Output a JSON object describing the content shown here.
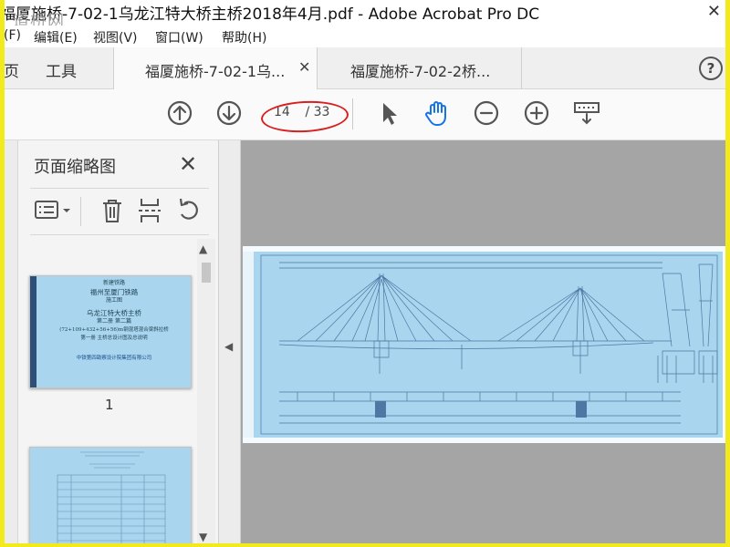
{
  "window": {
    "title": "福厦施桥-7-02-1乌龙江特大桥主桥2018年4月.pdf - Adobe Acrobat Pro DC",
    "watermark": "道桥网",
    "close_label": "✕"
  },
  "menu": {
    "items": [
      "(F)",
      "编辑(E)",
      "视图(V)",
      "窗口(W)",
      "帮助(H)"
    ]
  },
  "tabs": {
    "home_partial": "页",
    "tools": "工具",
    "documents": [
      {
        "label": "福厦施桥-7-02-1乌...",
        "active": true
      },
      {
        "label": "福厦施桥-7-02-2桥...",
        "active": false
      }
    ],
    "close_glyph": "✕",
    "help_glyph": "?"
  },
  "toolbar": {
    "icons": [
      "prev-page-icon",
      "next-page-icon",
      "select-arrow-icon",
      "hand-tool-icon",
      "zoom-out-icon",
      "zoom-in-icon",
      "keyboard-icon"
    ],
    "current_page": "14",
    "total_pages": "/ 33",
    "accent_color": "#1473e6",
    "annotation_color": "#d92020"
  },
  "sidebar": {
    "title": "页面缩略图",
    "close_glyph": "✕",
    "tools": [
      "options-icon",
      "delete-icon",
      "extract-icon",
      "rotate-icon"
    ],
    "thumbnails": [
      {
        "number": "1",
        "lines": [
          "新建铁路",
          "福州至厦门铁路",
          "施工图",
          "乌龙江特大桥主桥",
          "第二册 第二篇",
          "(72+109+432+56+56)m钢混塔混合梁斜拉桥",
          "第一册 主桥总设计图及总说明",
          "中铁第四勘察设计院集团有限公司"
        ]
      },
      {
        "number": "",
        "lines": []
      }
    ],
    "scroll_up": "▲",
    "scroll_down": "▼"
  },
  "viewer": {
    "collapse_glyph": "◀",
    "page_background": "#f4fafd",
    "drawing_color": "#a9d5ef"
  }
}
